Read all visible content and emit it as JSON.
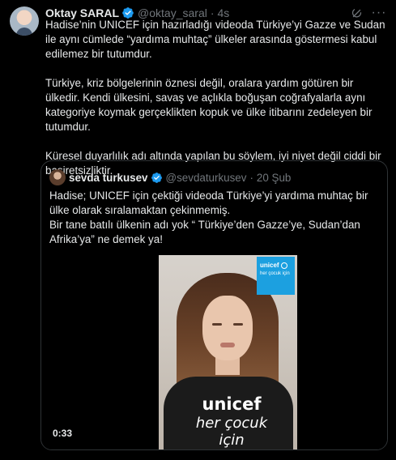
{
  "tweet": {
    "author_name": "Oktay SARAL",
    "author_handle": "@oktay_saral",
    "separator": "·",
    "time": "4s",
    "paragraphs": [
      "Hadise’nin UNICEF için hazırladığı videoda Türkiye’yi Gazze ve Sudan ile aynı cümlede “yardıma muhtaç” ülkeler arasında göstermesi kabul edilemez bir tutumdur.",
      "Türkiye, kriz bölgelerinin öznesi değil, oralara yardım götüren bir ülkedir. Kendi ülkesini, savaş ve açlıkla boğuşan coğrafyalarla aynı kategoriye koymak gerçeklikten kopuk ve ülke itibarını zedeleyen bir tutumdur.",
      "Küresel duyarlılık adı altında yapılan bu söylem, iyi niyet değil ciddi bir basiretsizliktir."
    ]
  },
  "quote": {
    "author_name": "sevda turkusev",
    "author_handle": "@sevdaturkusev",
    "separator": "·",
    "date": "20 Şub",
    "lines": [
      "Hadise; UNICEF için çektiği videoda Türkiye’yi yardıma muhtaç bir ülke olarak sıralamaktan çekinmemiş.",
      "Bir tane batılı ülkenin adı yok “ Türkiye’den Gazze’ye, Sudan’dan Afrika’ya” ne demek ya!"
    ],
    "video": {
      "duration": "0:33",
      "overlay_logo": "unicef",
      "overlay_tagline": "her çocuk için",
      "shirt_logo": "unicef",
      "shirt_tagline": "her çocuk için"
    }
  },
  "icons": {
    "verified": "verified-badge-icon",
    "grok": "grok-icon",
    "more": "more-icon"
  },
  "colors": {
    "background": "#000000",
    "text": "#e7e9ea",
    "secondary": "#71767b",
    "verified": "#1d9bf0",
    "unicef": "#1ca0e0",
    "border": "#2f3336"
  }
}
